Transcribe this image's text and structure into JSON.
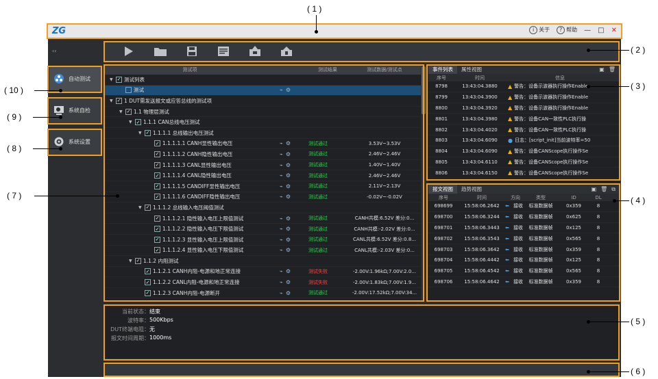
{
  "window": {
    "about_label": "关于",
    "help_label": "帮助",
    "collapse_glyph": "‹‹",
    "logo_text": "ZG"
  },
  "toolbar": {
    "buttons": [
      {
        "icon": "play-icon"
      },
      {
        "icon": "folder-open-icon"
      },
      {
        "icon": "save-icon"
      },
      {
        "icon": "report-icon"
      },
      {
        "icon": "export-icon"
      },
      {
        "icon": "import-icon"
      }
    ]
  },
  "sidebar": {
    "items": [
      {
        "label": "自动测试",
        "icon": "auto-test-icon",
        "active": true
      },
      {
        "label": "系统自检",
        "icon": "self-check-icon",
        "active": false
      },
      {
        "label": "系统设置",
        "icon": "gear-icon",
        "active": false
      }
    ]
  },
  "tree": {
    "headers": [
      "测试项",
      "测试结果",
      "测试数据/测试点"
    ],
    "rows": [
      {
        "indent": 0,
        "arrow": "▼",
        "check": true,
        "label": "测试列表",
        "icons": false,
        "result": "",
        "status": "",
        "data": ""
      },
      {
        "indent": 1,
        "arrow": "",
        "check": false,
        "label": "测试",
        "icons": true,
        "result": "",
        "status": "",
        "data": "",
        "selected": true
      },
      {
        "indent": 0,
        "arrow": "▼",
        "check": true,
        "label": "1 DUT需发送报文或应答总线的测试项",
        "icons": false,
        "result": "",
        "status": "",
        "data": ""
      },
      {
        "indent": 1,
        "arrow": "▼",
        "check": true,
        "label": "1.1 物理层测试",
        "icons": false,
        "result": "",
        "status": "",
        "data": ""
      },
      {
        "indent": 2,
        "arrow": "▼",
        "check": true,
        "label": "1.1.1 CAN总线电压测试",
        "icons": false,
        "result": "",
        "status": "",
        "data": ""
      },
      {
        "indent": 3,
        "arrow": "▼",
        "check": true,
        "label": "1.1.1.1 总线输出电压测试",
        "icons": false,
        "result": "",
        "status": "",
        "data": ""
      },
      {
        "indent": 4,
        "arrow": "",
        "check": true,
        "label": "1.1.1.1.1 CANH显性输出电压",
        "icons": true,
        "result": "测试通过",
        "status": "pass",
        "data": "3.53V~3.53V"
      },
      {
        "indent": 4,
        "arrow": "",
        "check": true,
        "label": "1.1.1.1.2 CANH隐性输出电压",
        "icons": true,
        "result": "测试通过",
        "status": "pass",
        "data": "2.46V~2.46V"
      },
      {
        "indent": 4,
        "arrow": "",
        "check": true,
        "label": "1.1.1.1.3 CANL显性输出电压",
        "icons": true,
        "result": "测试通过",
        "status": "pass",
        "data": "1.40V~1.40V"
      },
      {
        "indent": 4,
        "arrow": "",
        "check": true,
        "label": "1.1.1.1.4 CANL隐性输出电压",
        "icons": true,
        "result": "测试通过",
        "status": "pass",
        "data": "2.46V~2.46V"
      },
      {
        "indent": 4,
        "arrow": "",
        "check": true,
        "label": "1.1.1.1.5 CANDIFF显性输出电压",
        "icons": true,
        "result": "测试通过",
        "status": "pass",
        "data": "2.11V~2.13V"
      },
      {
        "indent": 4,
        "arrow": "",
        "check": true,
        "label": "1.1.1.1.6 CANDIFF隐性输出电压",
        "icons": true,
        "result": "测试通过",
        "status": "pass",
        "data": "-0.02V~-0.02V"
      },
      {
        "indent": 3,
        "arrow": "▼",
        "check": true,
        "label": "1.1.1.2 总线输入电压阈值测试",
        "icons": false,
        "result": "",
        "status": "",
        "data": ""
      },
      {
        "indent": 4,
        "arrow": "",
        "check": true,
        "label": "1.1.1.2.1 隐性输入电压上限值测试",
        "icons": true,
        "result": "测试通过",
        "status": "pass",
        "data": "CANH共模:6.52V 差分:0..."
      },
      {
        "indent": 4,
        "arrow": "",
        "check": true,
        "label": "1.1.1.2.2 隐性输入电压下限值测试",
        "icons": true,
        "result": "测试通过",
        "status": "pass",
        "data": "CANH共模:-2.02V 差分:0..."
      },
      {
        "indent": 4,
        "arrow": "",
        "check": true,
        "label": "1.1.1.2.3 显性输入电压上限值测试",
        "icons": true,
        "result": "测试通过",
        "status": "pass",
        "data": "CANL共模:6.52V 差分:0.8..."
      },
      {
        "indent": 4,
        "arrow": "",
        "check": true,
        "label": "1.1.1.2.4 显性输入电压下限值测试",
        "icons": true,
        "result": "测试通过",
        "status": "pass",
        "data": "CANL共模:-2.03V 差分:0..."
      },
      {
        "indent": 2,
        "arrow": "▼",
        "check": true,
        "label": "1.1.2 内阻测试",
        "icons": false,
        "result": "",
        "status": "",
        "data": ""
      },
      {
        "indent": 3,
        "arrow": "",
        "check": true,
        "label": "1.1.2.1 CANH内阻-电源和地正常连接",
        "icons": true,
        "result": "测试失败",
        "status": "fail",
        "data": "-2.00V:1.96kΩ;7.00V:2.0..."
      },
      {
        "indent": 3,
        "arrow": "",
        "check": true,
        "label": "1.1.2.2 CANL内阻-电源和地正常连接",
        "icons": true,
        "result": "测试失败",
        "status": "fail",
        "data": "-2.00V:1.83kΩ;7.00V:1.9..."
      },
      {
        "indent": 3,
        "arrow": "",
        "check": true,
        "label": "1.1.2.3 CANH内阻-电源断开",
        "icons": true,
        "result": "测试通过",
        "status": "pass",
        "data": "-2.00V:17.52kΩ;7.00V:34..."
      }
    ]
  },
  "event_panel": {
    "tabs": [
      "事件列表",
      "属性视图"
    ],
    "headers": [
      "序号",
      "时间",
      "信息"
    ],
    "rows": [
      {
        "id": "8798",
        "time": "13:43:04.3880",
        "level": "warn",
        "msg": "警告：设备示波器执行操作Enable"
      },
      {
        "id": "8799",
        "time": "13:43:04.3900",
        "level": "warn",
        "msg": "警告：设备示波器执行操作Enable"
      },
      {
        "id": "8800",
        "time": "13:43:04.3920",
        "level": "warn",
        "msg": "警告：设备示波器执行操作Enable"
      },
      {
        "id": "8801",
        "time": "13:43:04.3980",
        "level": "warn",
        "msg": "警告：设备CAN一致性PLC执行操"
      },
      {
        "id": "8802",
        "time": "13:43:04.4020",
        "level": "warn",
        "msg": "警告：设备CAN一致性PLC执行操"
      },
      {
        "id": "8803",
        "time": "13:43:04.6090",
        "level": "info",
        "msg": "日志：[script_init]当前波特率=50"
      },
      {
        "id": "8804",
        "time": "13:43:04.6090",
        "level": "warn",
        "msg": "警告：设备CANScope执行操作Se"
      },
      {
        "id": "8805",
        "time": "13:43:04.6110",
        "level": "warn",
        "msg": "警告：设备CANScope执行操作Se"
      },
      {
        "id": "8806",
        "time": "13:43:04.6150",
        "level": "warn",
        "msg": "警告：设备CANScope执行操作Se"
      }
    ]
  },
  "frame_panel": {
    "tabs": [
      "报文视图",
      "趋势视图"
    ],
    "headers": [
      "序号",
      "时间",
      "方向",
      "类型",
      "ID",
      "DL"
    ],
    "rows": [
      {
        "id": "698699",
        "time": "15:58:06.2642",
        "dir": "接收",
        "type": "标准数据帧",
        "fid": "0x359",
        "dl": "8"
      },
      {
        "id": "698700",
        "time": "15:58:06.3244",
        "dir": "接收",
        "type": "标准数据帧",
        "fid": "0x625",
        "dl": "8"
      },
      {
        "id": "698701",
        "time": "15:58:06.3443",
        "dir": "接收",
        "type": "标准数据帧",
        "fid": "0x125",
        "dl": "8"
      },
      {
        "id": "698702",
        "time": "15:58:06.3543",
        "dir": "接收",
        "type": "标准数据帧",
        "fid": "0x565",
        "dl": "8"
      },
      {
        "id": "698703",
        "time": "15:58:06.3642",
        "dir": "接收",
        "type": "标准数据帧",
        "fid": "0x359",
        "dl": "8"
      },
      {
        "id": "698704",
        "time": "15:58:06.4442",
        "dir": "接收",
        "type": "标准数据帧",
        "fid": "0x125",
        "dl": "8"
      },
      {
        "id": "698705",
        "time": "15:58:06.4542",
        "dir": "接收",
        "type": "标准数据帧",
        "fid": "0x565",
        "dl": "8"
      },
      {
        "id": "698706",
        "time": "15:58:06.4642",
        "dir": "接收",
        "type": "标准数据帧",
        "fid": "0x359",
        "dl": "8"
      }
    ]
  },
  "status": {
    "lines": [
      {
        "label": "当前状态：",
        "value": "结束"
      },
      {
        "label": "波特率：",
        "value": "500Kbps"
      },
      {
        "label": "DUT终端电阻：",
        "value": "无"
      },
      {
        "label": "报文时间周期：",
        "value": "1000ms"
      }
    ]
  },
  "callouts": {
    "c1": "( 1 )",
    "c2": "( 2 )",
    "c3": "( 3 )",
    "c4": "( 4 )",
    "c5": "( 5 )",
    "c6": "( 6 )",
    "c7": "( 7 )",
    "c8": "( 8 )",
    "c9": "( 9 )",
    "c10": "( 10 )"
  },
  "colors": {
    "callout": "#f0a020",
    "pass": "#33cc55",
    "fail": "#ff4444",
    "warn": "#f0b400",
    "selection": "#1b4f78"
  }
}
